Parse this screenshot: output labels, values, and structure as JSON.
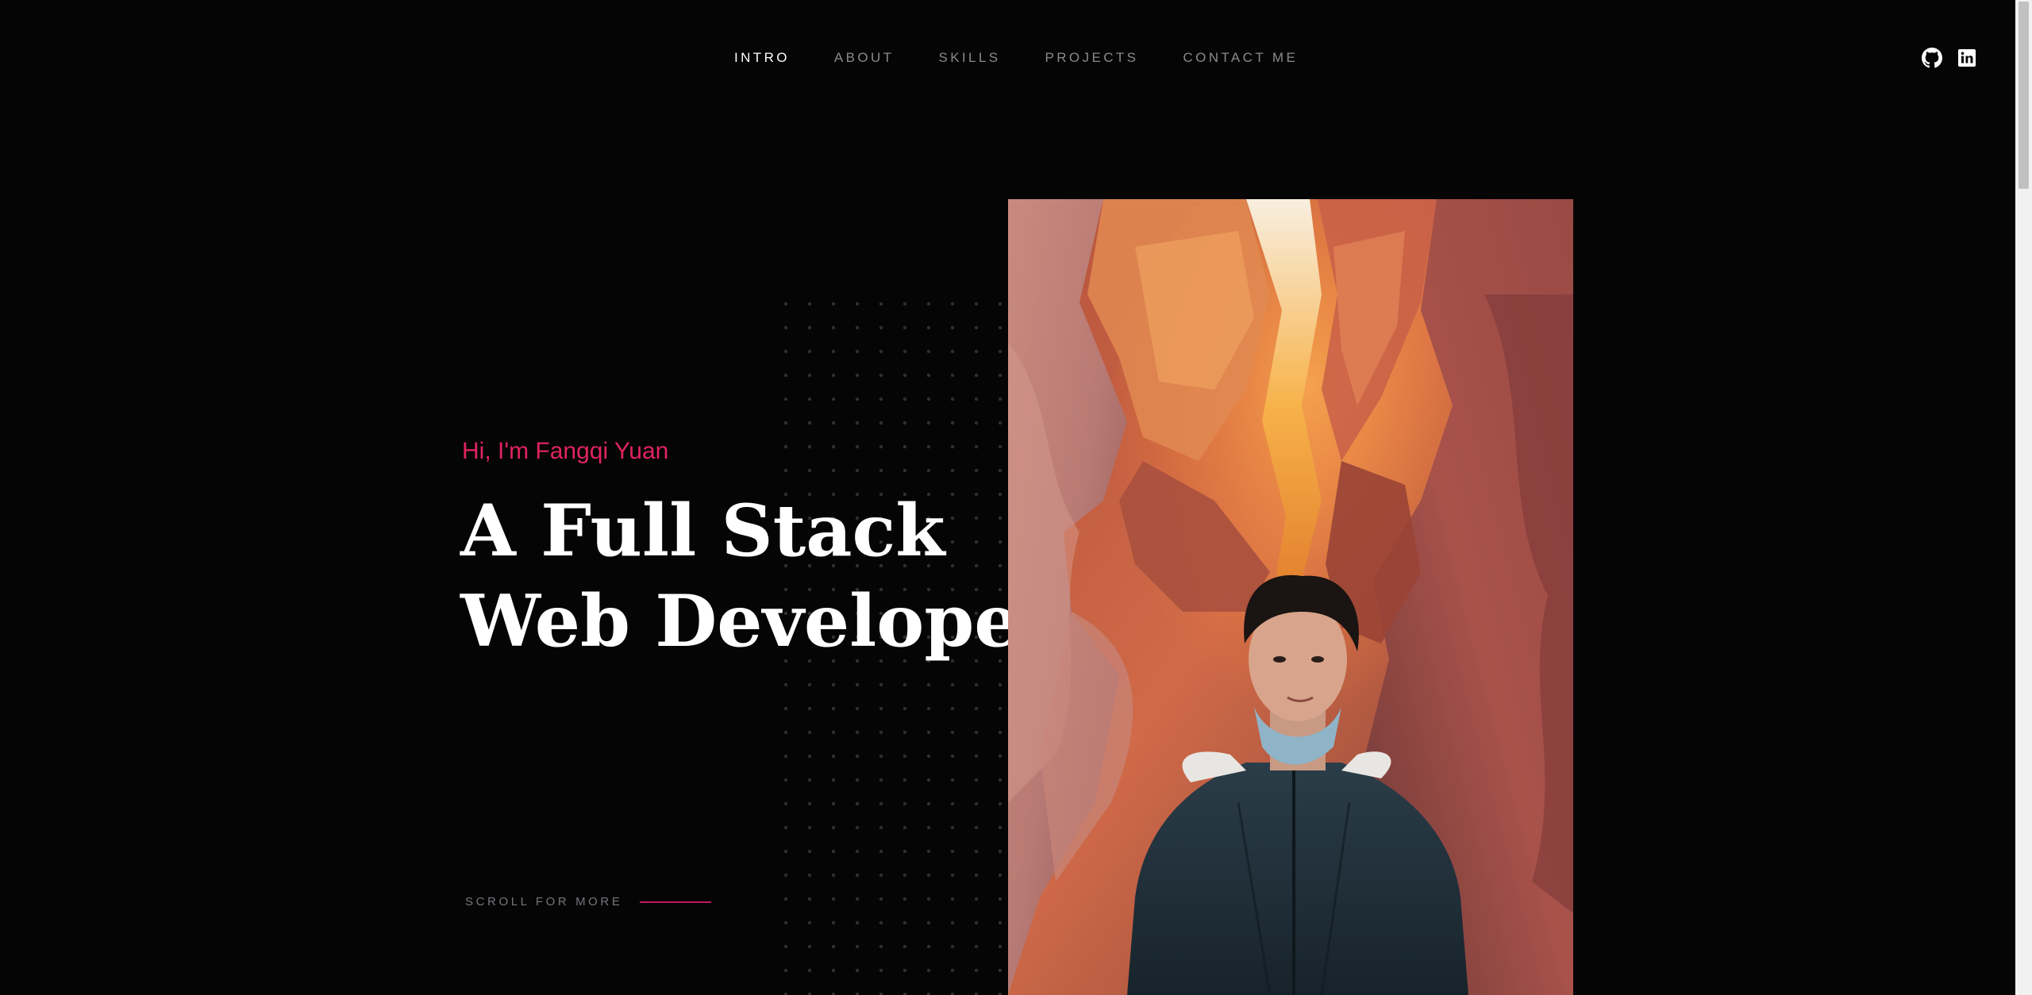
{
  "nav": {
    "items": [
      {
        "label": "INTRO",
        "active": true
      },
      {
        "label": "ABOUT",
        "active": false
      },
      {
        "label": "SKILLS",
        "active": false
      },
      {
        "label": "PROJECTS",
        "active": false
      },
      {
        "label": "CONTACT ME",
        "active": false
      }
    ]
  },
  "social": {
    "github_icon": "github-icon",
    "linkedin_icon": "linkedin-icon"
  },
  "hero": {
    "greeting": "Hi, I'm Fangqi Yuan",
    "headline_line1": "A Full Stack",
    "headline_line2": "Web Developer",
    "scroll_hint": "SCROLL FOR MORE"
  },
  "colors": {
    "background": "#050506",
    "accent": "#e0245e",
    "nav_inactive": "#8a8a8a",
    "nav_active": "#ffffff"
  }
}
